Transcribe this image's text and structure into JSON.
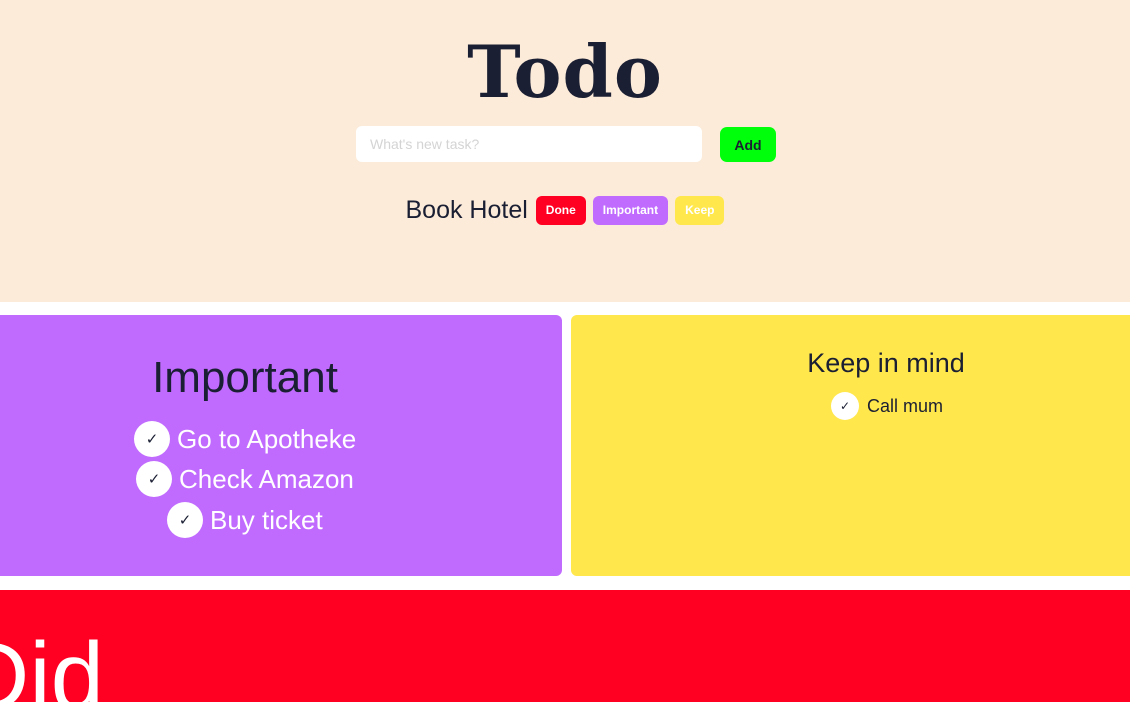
{
  "header": {
    "title": "Todo",
    "input_placeholder": "What's new task?",
    "input_value": "",
    "add_label": "Add"
  },
  "pending": {
    "task": "Book Hotel",
    "done_label": "Done",
    "important_label": "Important",
    "keep_label": "Keep"
  },
  "important": {
    "title": "Important",
    "items": [
      "Go to Apotheke",
      "Check Amazon",
      "Buy ticket"
    ]
  },
  "keep": {
    "title": "Keep in mind",
    "items": [
      "Call mum"
    ]
  },
  "did": {
    "title": "Did"
  },
  "icons": {
    "check": "checkmark-icon"
  },
  "colors": {
    "header_bg": "#fcebd9",
    "add_button": "#00ff0a",
    "done": "#ff0022",
    "important": "#c06bfe",
    "keep": "#ffe74c"
  }
}
